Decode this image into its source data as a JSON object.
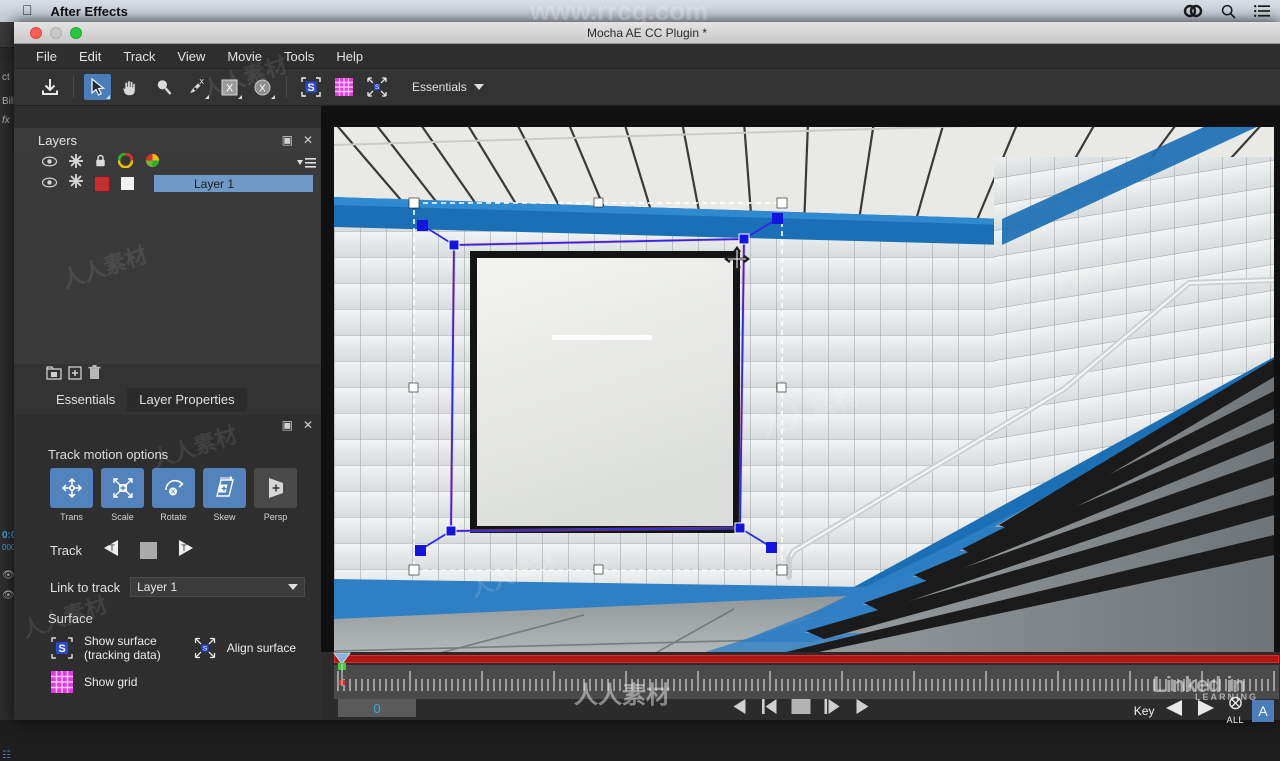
{
  "os_menubar": {
    "apple_icon": "apple-icon",
    "app_title": "After Effects",
    "right_icons": [
      "creative-cloud-icon",
      "search-icon",
      "list-menu-icon"
    ]
  },
  "ae_background": {
    "fragments": [
      "ct",
      "Billb",
      "fx",
      "0:0",
      "000"
    ]
  },
  "window": {
    "title": "Mocha AE CC Plugin *",
    "traffic_lights": [
      "close",
      "minimize",
      "zoom"
    ]
  },
  "menubar": {
    "items": [
      "File",
      "Edit",
      "Track",
      "View",
      "Movie",
      "Tools",
      "Help"
    ]
  },
  "toolbar": {
    "tools": [
      {
        "name": "import-icon",
        "label": "Import",
        "selected": false,
        "corner": false
      },
      {
        "name": "pointer-icon",
        "label": "Select",
        "selected": true,
        "corner": true
      },
      {
        "name": "hand-icon",
        "label": "Pan",
        "selected": false,
        "corner": false
      },
      {
        "name": "zoom-icon",
        "label": "Zoom",
        "selected": false,
        "corner": false
      },
      {
        "name": "pen-x-icon",
        "label": "Add X-Spline",
        "selected": false,
        "corner": true
      },
      {
        "name": "x-square-icon",
        "label": "X-Spline",
        "selected": false,
        "corner": true
      },
      {
        "name": "x-circle-icon",
        "label": "Bezier",
        "selected": false,
        "corner": true
      },
      {
        "name": "surface-s-icon",
        "label": "Show Surface",
        "selected": false,
        "corner": false
      },
      {
        "name": "grid-icon",
        "label": "Show Grid",
        "selected": false,
        "corner": false
      },
      {
        "name": "align-surface-icon",
        "label": "Align Surface",
        "selected": false,
        "corner": false
      }
    ],
    "workspace": "Essentials"
  },
  "layers_panel": {
    "title": "Layers",
    "header_icons": [
      "eye-icon",
      "gear-icon",
      "lock-icon",
      "color-wheel-icon",
      "color-wheel-2-icon"
    ],
    "menu_icon": "panel-menu-icon",
    "rows": [
      {
        "name": "Layer 1",
        "visible": true,
        "gear": true,
        "color_swatch": "#b33333",
        "mask_swatch": "#f2f2f2",
        "selected": true
      }
    ],
    "footer_icons": [
      "new-folder-icon",
      "new-layer-icon",
      "delete-icon"
    ],
    "close_icon": "close-icon",
    "float_icon": "float-panel-icon"
  },
  "tabs": [
    {
      "label": "Essentials",
      "active": false
    },
    {
      "label": "Layer Properties",
      "active": true
    }
  ],
  "essentials": {
    "track_motion_title": "Track motion options",
    "motion_options": [
      {
        "label": "Trans",
        "icon": "move-arrows-icon",
        "enabled": true
      },
      {
        "label": "Scale",
        "icon": "scale-arrows-icon",
        "enabled": true
      },
      {
        "label": "Rotate",
        "icon": "rotate-icon",
        "enabled": true
      },
      {
        "label": "Skew",
        "icon": "skew-icon",
        "enabled": true
      },
      {
        "label": "Persp",
        "icon": "perspective-icon",
        "enabled": false
      }
    ],
    "track_label": "Track",
    "track_buttons": [
      "track-backward-icon",
      "track-stop-icon",
      "track-forward-icon"
    ],
    "link_label": "Link to track",
    "link_value": "Layer 1",
    "surface_title": "Surface",
    "surface_options": [
      {
        "label": "Show surface\n(tracking data)",
        "line1": "Show surface",
        "line2": "(tracking data)",
        "icon": "surface-s-icon"
      },
      {
        "label": "Align surface",
        "line1": "Align surface",
        "line2": "",
        "icon": "align-surface-icon"
      },
      {
        "label": "Show grid",
        "line1": "Show grid",
        "line2": "",
        "icon": "grid-icon"
      }
    ]
  },
  "timeline": {
    "current_frame": "0",
    "transport_buttons": [
      "step-back-icon",
      "prev-keyframe-icon",
      "stop-icon",
      "play-forward-icon",
      "fast-forward-icon"
    ],
    "key_label": "Key",
    "key_prev_icon": "key-prev-icon",
    "key_next_icon": "key-next-icon",
    "all_label": "ALL",
    "all_icon": "all-keys-icon",
    "a_button": "A"
  },
  "viewer": {
    "scene": "subway-stairwell-with-blank-billboard",
    "tracking_shape": {
      "spline_color": "#2a2aff",
      "mesh_color": "#e05050",
      "surface_color": "#ffffff",
      "points": 8
    }
  },
  "watermarks": {
    "url": "www.rrcg.com",
    "linkedin": "Linked in",
    "learning": "LEARNING",
    "cn_site": "人人素材"
  },
  "colors": {
    "accent_blue": "#4a7ebb",
    "panel_bg": "#333333",
    "window_bg": "#2e2e2e",
    "selection_blue": "#6f9ac8",
    "pink_grid": "#e040e0",
    "timeline_red": "#b01414"
  }
}
